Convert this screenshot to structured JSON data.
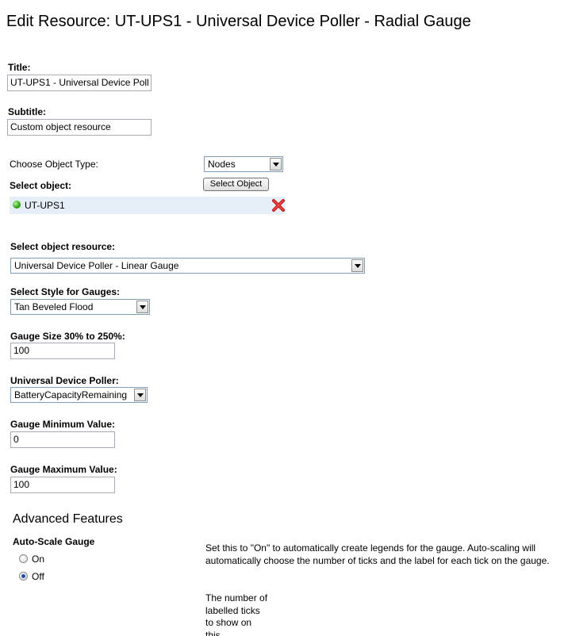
{
  "page": {
    "title": "Edit Resource: UT-UPS1 - Universal Device Poller - Radial Gauge"
  },
  "title_field": {
    "label": "Title:",
    "value": "UT-UPS1 - Universal Device Poll"
  },
  "subtitle_field": {
    "label": "Subtitle:",
    "value": "Custom object resource"
  },
  "object_type": {
    "label": "Choose Object Type:",
    "selected": "Nodes"
  },
  "select_object": {
    "label": "Select object:",
    "button_label": "Select Object",
    "selected_object": "UT-UPS1",
    "status_color": "#2ba50f",
    "status_icon": "green-status-icon",
    "remove_icon": "red-x-icon"
  },
  "object_resource": {
    "label": "Select object resource:",
    "selected": "Universal Device Poller - Linear Gauge"
  },
  "gauge_style": {
    "label": "Select Style for Gauges:",
    "selected": "Tan Beveled Flood"
  },
  "gauge_size": {
    "label": "Gauge Size 30% to 250%:",
    "value": "100"
  },
  "poller": {
    "label": "Universal Device Poller:",
    "selected": "BatteryCapacityRemaining"
  },
  "gauge_min": {
    "label": "Gauge Minimum Value:",
    "value": "0"
  },
  "gauge_max": {
    "label": "Gauge Maximum Value:",
    "value": "100"
  },
  "advanced": {
    "heading": "Advanced Features",
    "autoscale_label": "Auto-Scale Gauge",
    "options": [
      {
        "label": "On",
        "checked": false
      },
      {
        "label": "Off",
        "checked": true
      }
    ],
    "help_text": "Set this to \"On\" to automatically create legends for the gauge. Auto-scaling will automatically choose the number of ticks and the label for each tick on the gauge.",
    "ticks_help_text": "The number of labelled ticks to show on this"
  }
}
